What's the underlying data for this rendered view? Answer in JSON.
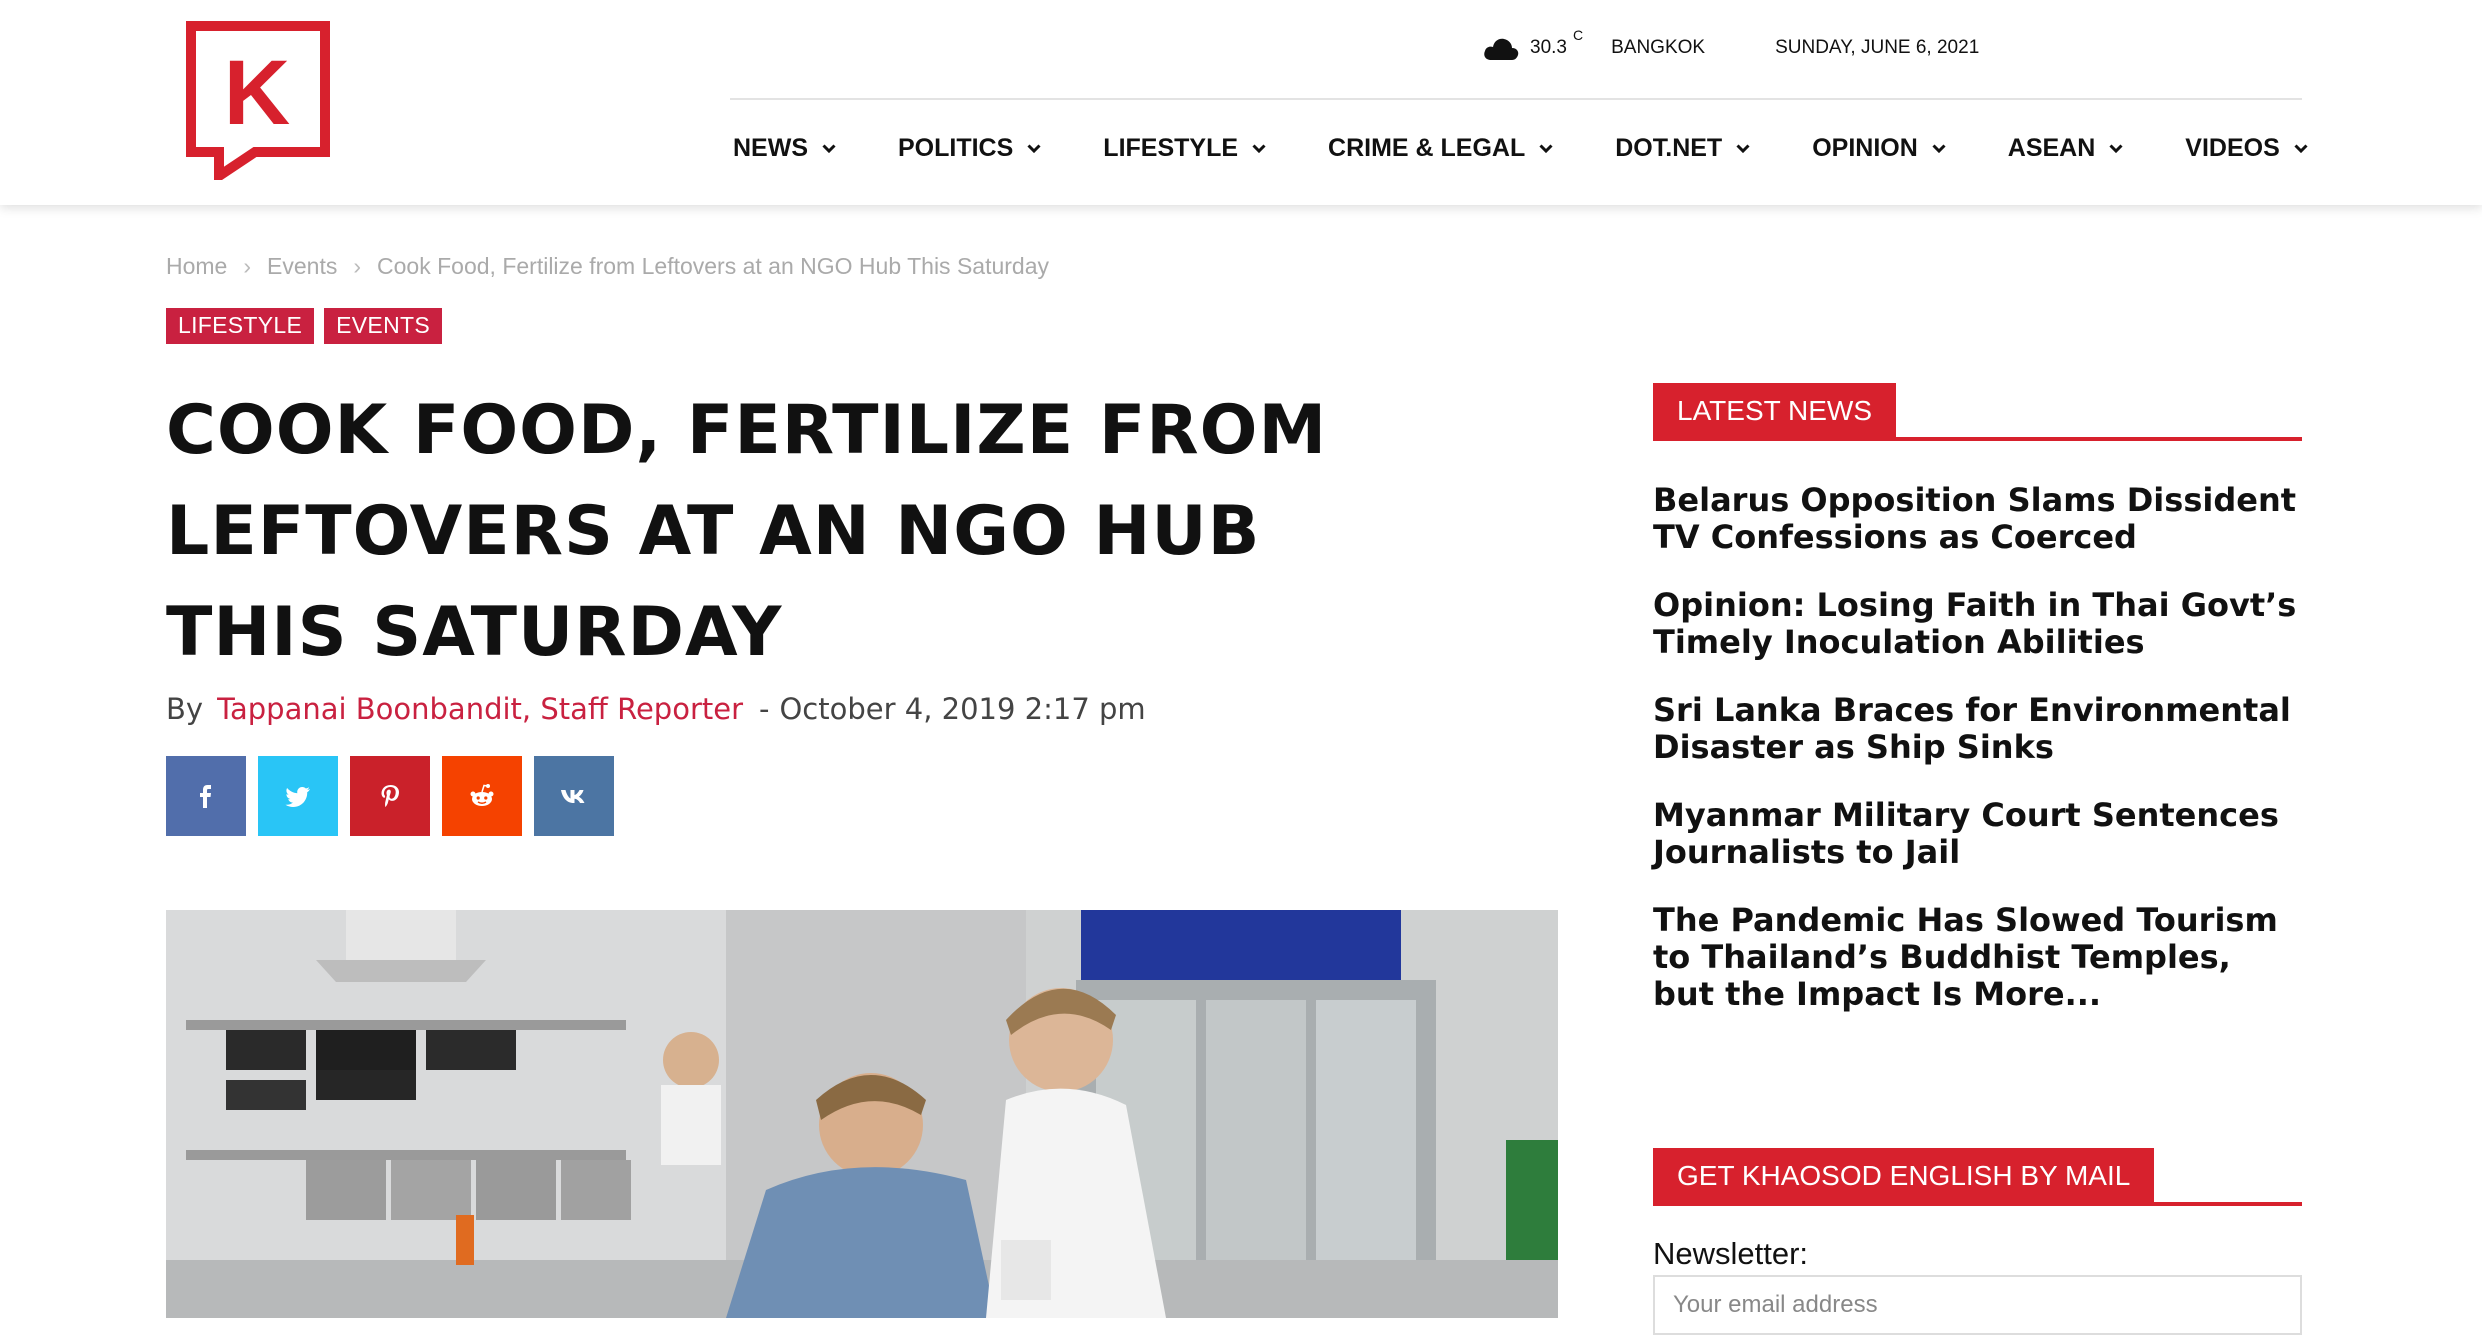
{
  "logo": {
    "letter": "K"
  },
  "weather": {
    "temperature": "30.3",
    "unit": "C",
    "city": "BANGKOK",
    "icon": "cloud-icon"
  },
  "date": "SUNDAY, JUNE 6, 2021",
  "nav": {
    "items": [
      {
        "label": "NEWS"
      },
      {
        "label": "POLITICS"
      },
      {
        "label": "LIFESTYLE"
      },
      {
        "label": "CRIME & LEGAL"
      },
      {
        "label": "DOT.NET"
      },
      {
        "label": "OPINION"
      },
      {
        "label": "ASEAN"
      },
      {
        "label": "VIDEOS"
      }
    ]
  },
  "breadcrumb": {
    "items": [
      "Home",
      "Events",
      "Cook Food, Fertilize from Leftovers at an NGO Hub This Saturday"
    ],
    "separator": "›"
  },
  "categories": [
    "LIFESTYLE",
    "EVENTS"
  ],
  "article": {
    "title": "COOK FOOD, FERTILIZE FROM LEFTOVERS AT AN NGO HUB THIS SATURDAY",
    "by": "By",
    "author": "Tappanai Boonbandit, Staff Reporter",
    "dash": "-",
    "published": "October 4, 2019 2:17 pm"
  },
  "share": [
    {
      "icon": "facebook-icon",
      "color": "#516eab"
    },
    {
      "icon": "twitter-icon",
      "color": "#29c5f6"
    },
    {
      "icon": "pinterest-icon",
      "color": "#ca212a"
    },
    {
      "icon": "reddit-icon",
      "color": "#f54200"
    },
    {
      "icon": "vk-icon",
      "color": "#4c75a3"
    }
  ],
  "sidebar": {
    "latest_title": "LATEST NEWS",
    "latest": [
      "Belarus Opposition Slams Dissident TV Confessions as Coerced",
      "Opinion: Losing Faith in Thai Govt’s Timely Inoculation Abilities",
      "Sri Lanka Braces for Environmental Disaster as Ship Sinks",
      "Myanmar Military Court Sentences Journalists to Jail",
      "The Pandemic Has Slowed Tourism to Thailand’s Buddhist Temples, but the Impact Is More..."
    ],
    "mail_title": "GET KHAOSOD ENGLISH BY MAIL",
    "newsletter_label": "Newsletter:",
    "email_placeholder": "Your email address"
  },
  "colors": {
    "brand_red": "#d7212d",
    "category_bg": "#c92140"
  }
}
